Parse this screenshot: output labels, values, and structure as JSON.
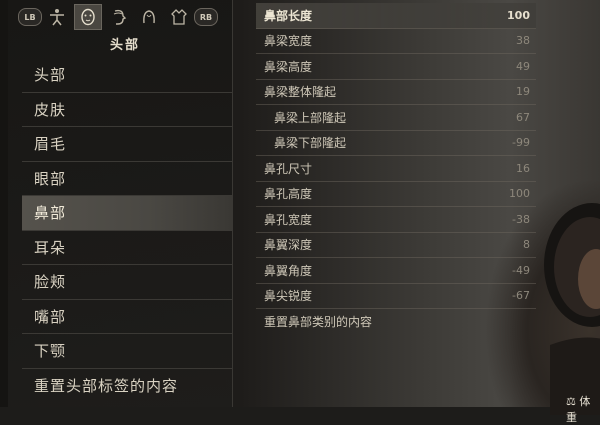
{
  "toolbar": {
    "lb_label": "LB",
    "rb_label": "RB",
    "icons": [
      "body-figure-icon",
      "face-mask-icon",
      "face-profile-icon",
      "hair-icon",
      "outfit-icon"
    ]
  },
  "section_title": "头部",
  "categories": [
    {
      "label": "头部"
    },
    {
      "label": "皮肤"
    },
    {
      "label": "眉毛"
    },
    {
      "label": "眼部"
    },
    {
      "label": "鼻部"
    },
    {
      "label": "耳朵"
    },
    {
      "label": "脸颊"
    },
    {
      "label": "嘴部"
    },
    {
      "label": "下颚"
    },
    {
      "label": "重置头部标签的内容"
    }
  ],
  "sliders": [
    {
      "label": "鼻部长度",
      "value": "100"
    },
    {
      "label": "鼻梁宽度",
      "value": "38"
    },
    {
      "label": "鼻梁高度",
      "value": "49"
    },
    {
      "label": "鼻梁整体隆起",
      "value": "19"
    },
    {
      "label": "鼻梁上部隆起",
      "value": "67"
    },
    {
      "label": "鼻梁下部隆起",
      "value": "-99"
    },
    {
      "label": "鼻孔尺寸",
      "value": "16"
    },
    {
      "label": "鼻孔高度",
      "value": "100"
    },
    {
      "label": "鼻孔宽度",
      "value": "-38"
    },
    {
      "label": "鼻翼深度",
      "value": "8"
    },
    {
      "label": "鼻翼角度",
      "value": "-49"
    },
    {
      "label": "鼻尖锐度",
      "value": "-67"
    }
  ],
  "reset_nose": "重置鼻部类别的内容",
  "weight_label": "体重"
}
